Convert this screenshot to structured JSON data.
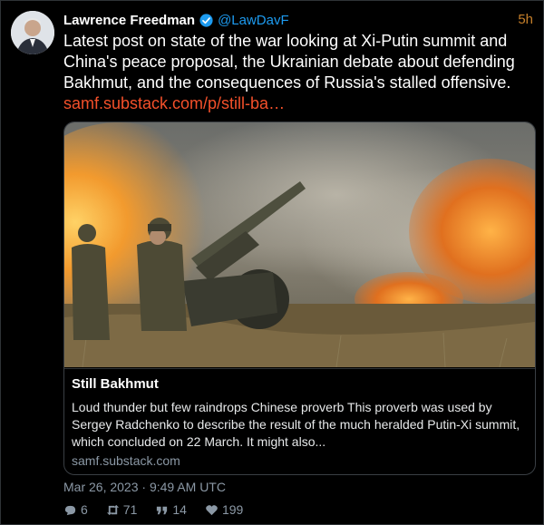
{
  "author": {
    "name": "Lawrence Freedman",
    "handle": "@LawDavF",
    "time": "5h"
  },
  "tweet": {
    "text": "Latest post on state of the war looking at Xi-Putin summit and China's peace proposal, the Ukrainian debate about defending Bakhmut, and the consequences of Russia's stalled offensive.",
    "link": "samf.substack.com/p/still-ba…"
  },
  "card": {
    "title": "Still Bakhmut",
    "description": "Loud thunder but few raindrops  Chinese proverb This proverb was used by Sergey Radchenko to describe the result of the much heralded Putin-Xi summit, which concluded on 22 March. It might also...",
    "domain": "samf.substack.com"
  },
  "timestamp": "Mar 26, 2023 · 9:49 AM UTC",
  "stats": {
    "replies": "6",
    "retweets": "71",
    "quotes": "14",
    "likes": "199"
  },
  "colors": {
    "accent": "#1d9bf0",
    "link": "#f4502a",
    "muted": "#8b98a5"
  }
}
